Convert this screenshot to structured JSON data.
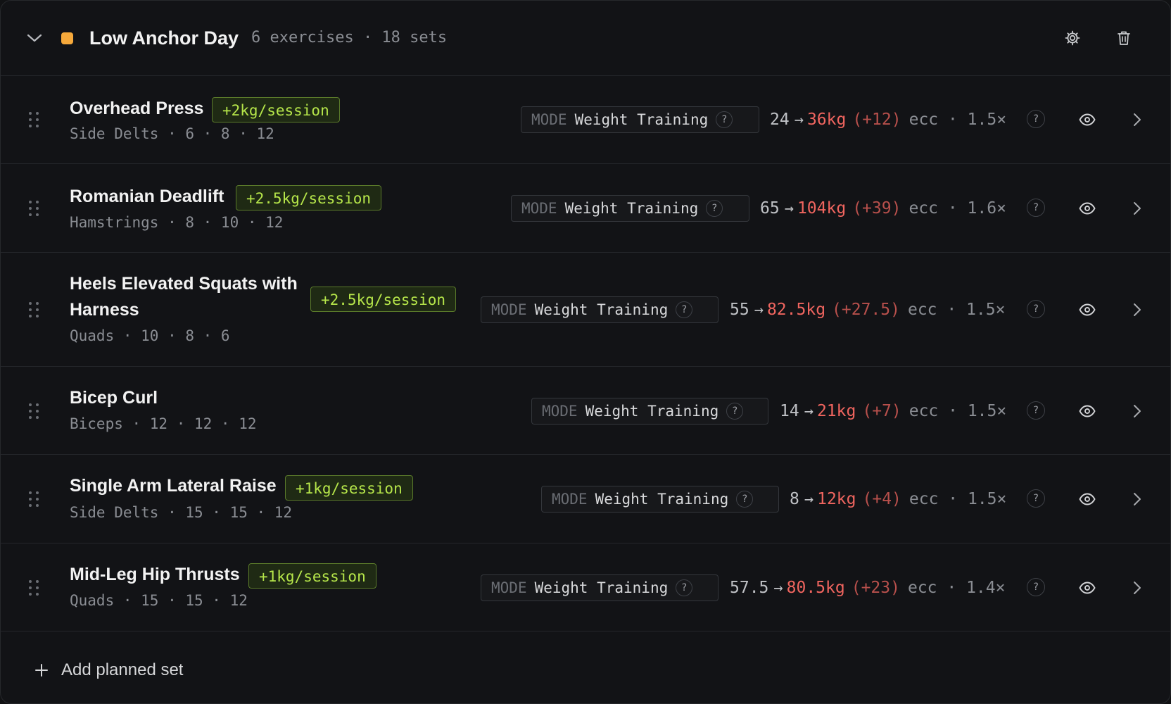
{
  "header": {
    "title": "Low Anchor Day",
    "meta": "6 exercises · 18 sets",
    "swatch_color": "#f6a93b",
    "icons": [
      "chevron-down-icon",
      "gear-icon",
      "trash-icon"
    ]
  },
  "exercises": [
    {
      "name": "Overhead Press",
      "increment": "+2kg/session",
      "sub": "Side Delts · 6 · 8 · 12",
      "mode_label": "MODE",
      "mode_value": "Weight Training",
      "q": "?",
      "from": "24",
      "arrow": "→",
      "to": "36kg",
      "delta": "(+12)",
      "ecc": "ecc · 1.5×"
    },
    {
      "name": "Romanian Deadlift",
      "increment": "+2.5kg/session",
      "sub": "Hamstrings · 8 · 10 · 12",
      "mode_label": "MODE",
      "mode_value": "Weight Training",
      "q": "?",
      "from": "65",
      "arrow": "→",
      "to": "104kg",
      "delta": "(+39)",
      "ecc": "ecc · 1.6×"
    },
    {
      "name_line1": "Heels Elevated Squats with",
      "name_line2": "Harness",
      "increment": "+2.5kg/session",
      "sub": "Quads · 10 · 8 · 6",
      "mode_label": "MODE",
      "mode_value": "Weight Training",
      "q": "?",
      "from": "55",
      "arrow": "→",
      "to": "82.5kg",
      "delta": "(+27.5)",
      "ecc": "ecc · 1.5×"
    },
    {
      "name": "Bicep Curl",
      "increment": "",
      "sub": "Biceps · 12 · 12 · 12",
      "mode_label": "MODE",
      "mode_value": "Weight Training",
      "q": "?",
      "from": "14",
      "arrow": "→",
      "to": "21kg",
      "delta": "(+7)",
      "ecc": "ecc · 1.5×"
    },
    {
      "name": "Single Arm Lateral Raise",
      "increment": "+1kg/session",
      "sub": "Side Delts · 15 · 15 · 12",
      "mode_label": "MODE",
      "mode_value": "Weight Training",
      "q": "?",
      "from": "8",
      "arrow": "→",
      "to": "12kg",
      "delta": "(+4)",
      "ecc": "ecc · 1.5×"
    },
    {
      "name": "Mid-Leg Hip Thrusts",
      "increment": "+1kg/session",
      "sub": "Quads · 15 · 15 · 12",
      "mode_label": "MODE",
      "mode_value": "Weight Training",
      "q": "?",
      "from": "57.5",
      "arrow": "→",
      "to": "80.5kg",
      "delta": "(+23)",
      "ecc": "ecc · 1.4×"
    }
  ],
  "footer": {
    "add_label": "Add planned set"
  },
  "colors": {
    "background": "#121316",
    "accent_increment": "#b6e64a",
    "target_weight": "#f0655f",
    "delta": "#b8504c"
  }
}
